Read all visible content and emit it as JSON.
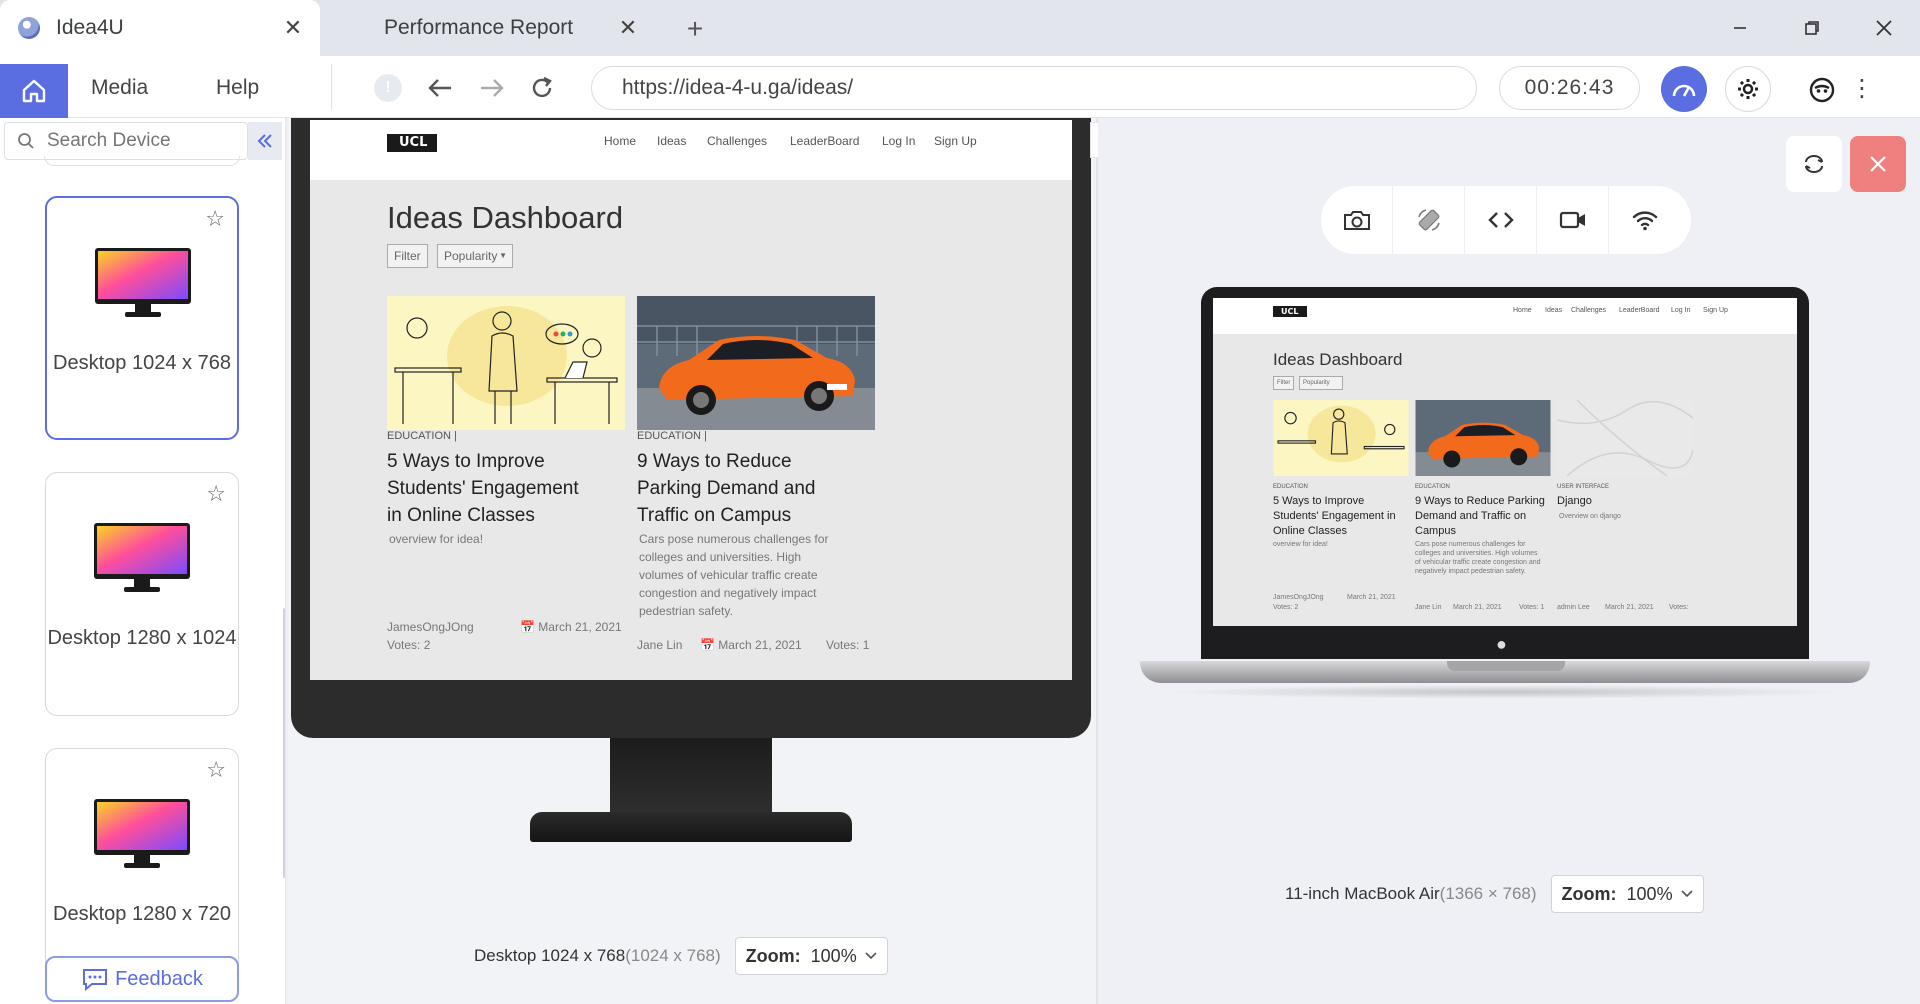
{
  "tabs": [
    {
      "title": "Idea4U",
      "active": true
    },
    {
      "title": "Performance Report",
      "active": false
    }
  ],
  "window_controls": {
    "minimize": "—",
    "maximize": "❐",
    "close": "✕"
  },
  "menu": {
    "media": "Media",
    "help": "Help"
  },
  "address": {
    "url": "https://idea-4-u.ga/ideas/"
  },
  "session_timer": "00:26:43",
  "accent_color": "#5b6ee1",
  "sidebar": {
    "search_placeholder": "Search Device",
    "devices": [
      {
        "label": "Desktop 1024 x 768",
        "selected": true
      },
      {
        "label": "Desktop 1280 x 1024",
        "selected": false
      },
      {
        "label": "Desktop 1280 x 720",
        "selected": false
      }
    ],
    "feedback_label": "Feedback"
  },
  "site": {
    "logo": "UCL",
    "nav": [
      "Home",
      "Ideas",
      "Challenges",
      "LeaderBoard",
      "Log In",
      "Sign Up"
    ],
    "title": "Ideas Dashboard",
    "filter_label": "Filter",
    "sort_label": "Popularity",
    "ideas": [
      {
        "category": "EDUCATION",
        "title": "5 Ways to Improve Students' Engagement in Online Classes",
        "desc": "overview for idea!",
        "author": "JamesOngJOng",
        "date": "March 21, 2021",
        "votes": "Votes: 2"
      },
      {
        "category": "EDUCATION",
        "title": "9 Ways to Reduce Parking Demand and Traffic on Campus",
        "desc": "Cars pose numerous challenges for colleges and universities. High volumes of vehicular traffic create congestion and negatively impact pedestrian safety.",
        "author": "Jane Lin",
        "date": "March 21, 2021",
        "votes": "Votes: 1"
      },
      {
        "category": "USER INTERFACE",
        "title": "Django",
        "desc": "Overview on django",
        "author": "admin Lee",
        "date": "March 21, 2021",
        "votes": "Votes:"
      }
    ]
  },
  "left_preview": {
    "device_name": "Desktop 1024 x 768",
    "resolution": "(1024 x 768)",
    "zoom_label": "Zoom:",
    "zoom_value": "100%"
  },
  "right_preview": {
    "device_name": "11-inch MacBook Air",
    "resolution": "(1366 × 768)",
    "zoom_label": "Zoom:",
    "zoom_value": "100%"
  },
  "tools": [
    "camera-icon",
    "rotate-icon",
    "code-icon",
    "video-icon",
    "wifi-icon"
  ]
}
